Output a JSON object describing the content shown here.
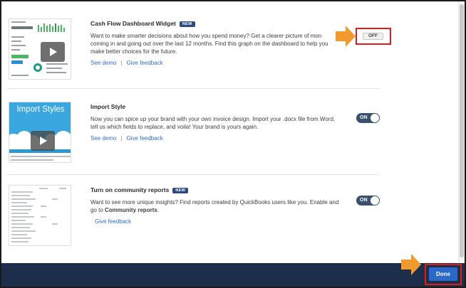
{
  "features": [
    {
      "title": "Cash Flow Dashboard Widget",
      "badge": "NEW",
      "description": "Want to make smarter decisions about how you spend money? Get a clearer picture of mon coming in and going out over the last 12 months. Find this graph on the dashboard to help you make better choices for the future.",
      "links": [
        "See demo",
        "Give feedback"
      ],
      "toggle": "OFF",
      "thumbnail_icon": "play-icon"
    },
    {
      "title": "Import Style",
      "badge": "",
      "description": "Now you can spice up your brand with your own invoice design. Import your .docx file from Word, tell us which fields to replace, and voila! Your brand is yours again.",
      "links": [
        "See demo",
        "Give feedback"
      ],
      "toggle": "ON",
      "thumbnail_icon": "play-icon",
      "thumbnail_title": "Import Styles"
    },
    {
      "title": "Turn on community reports",
      "badge": "NEW",
      "description_pre": "Want to see more unique insights? Find reports created by QuickBooks users like you. Enable and go to ",
      "description_bold": "Community reports",
      "description_post": ".",
      "links": [
        "Give feedback"
      ],
      "toggle": "ON"
    }
  ],
  "footer": {
    "done_label": "Done"
  },
  "colors": {
    "accent": "#2b69c9",
    "footer_bg": "#1c2e4a",
    "badge_bg": "#2f4a7d",
    "toggle_on": "#39506f",
    "highlight": "#e11a1a",
    "annotation_arrow": "#f29a2e"
  }
}
